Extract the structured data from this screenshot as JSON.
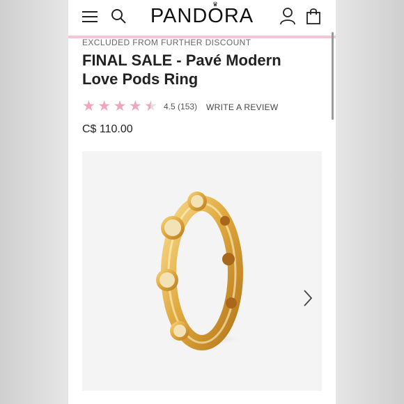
{
  "header": {
    "logo": "PANDORA",
    "icons": [
      "hamburger-menu-icon",
      "search-icon",
      "account-icon",
      "shopping-bag-icon"
    ],
    "accent_rule_color": "#f2c7d2"
  },
  "product": {
    "notice": "EXCLUDED FROM FURTHER DISCOUNT",
    "title": "FINAL SALE - Pavé Modern Love Pods Ring",
    "rating": "4.5",
    "rating_value": 4.5,
    "rating_max": 5,
    "review_count": "(153)",
    "write_review": "WRITE A REVIEW",
    "price": "C$ 110.00",
    "star_color": "#f0a6bd"
  },
  "gallery": {
    "next_icon": "chevron-right-icon"
  }
}
